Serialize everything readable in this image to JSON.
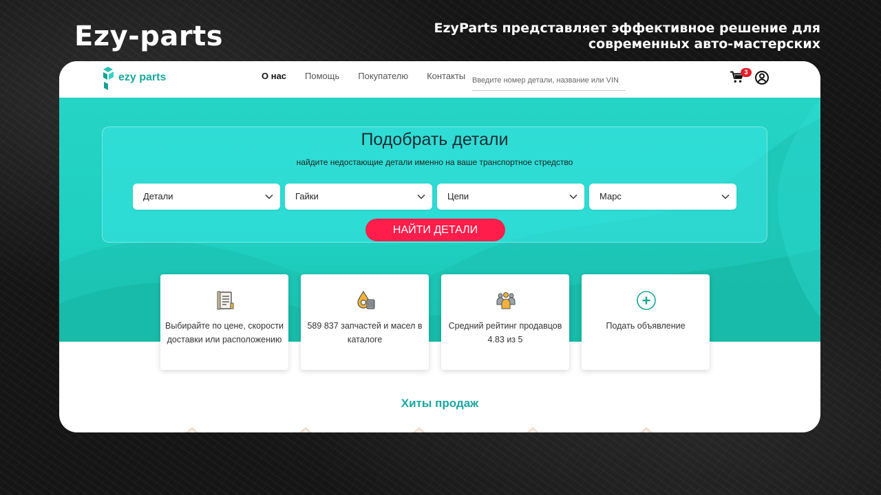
{
  "slide": {
    "title": "Ezy-parts",
    "subtitle": "EzyParts представляет эффективное решение для современных авто-мастерских"
  },
  "site": {
    "logo_text": "ezy parts",
    "nav": [
      {
        "label": "О нас",
        "active": true
      },
      {
        "label": "Помощь",
        "active": false
      },
      {
        "label": "Покупателю",
        "active": false
      },
      {
        "label": "Контакты",
        "active": false
      }
    ],
    "search_placeholder": "Введите номер детали, название или VIN",
    "cart_count": "3",
    "icons": {
      "cart": "cart-icon",
      "user": "user-icon"
    }
  },
  "finder": {
    "title": "Подобрать детали",
    "subtitle": "найдите недостающие детали именно на ваше транспортное стредство",
    "selects": [
      "Детали",
      "Гайки",
      "Цепи",
      "Марс"
    ],
    "button": "НАЙТИ ДЕТАЛИ"
  },
  "cards": [
    {
      "icon": "document-list-icon",
      "text": "Выбирайте по цене, скорости доставки или расположению"
    },
    {
      "icon": "oil-drop-gear-icon",
      "text": "589 837 запчастей и масел в каталоге"
    },
    {
      "icon": "sellers-group-icon",
      "text": "Средний рейтинг продавцов 4.83 из 5"
    },
    {
      "icon": "plus-circle-icon",
      "text": "Подать объявление"
    }
  ],
  "hits_title": "Хиты продаж",
  "colors": {
    "brand_teal": "#19a79a",
    "hero": "#26d4c6",
    "cta": "#ff1e4b",
    "section_title": "#1aa6a1",
    "badge": "#e0202b"
  }
}
